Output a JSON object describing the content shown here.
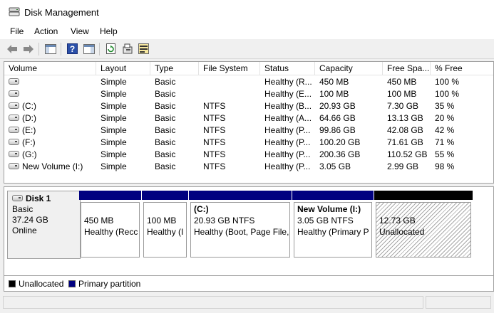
{
  "window": {
    "title": "Disk Management"
  },
  "menu": [
    "File",
    "Action",
    "View",
    "Help"
  ],
  "toolbar": {
    "buttons": [
      "back-icon",
      "forward-icon",
      "console-tree-icon",
      "help-icon",
      "show-hide-icon",
      "refresh-icon",
      "properties-icon",
      "rescan-disks-icon"
    ]
  },
  "volume_list": {
    "columns": [
      "Volume",
      "Layout",
      "Type",
      "File System",
      "Status",
      "Capacity",
      "Free Spa...",
      "% Free"
    ],
    "rows": [
      {
        "volume": "",
        "layout": "Simple",
        "type": "Basic",
        "fs": "",
        "status": "Healthy (R...",
        "capacity": "450 MB",
        "free": "450 MB",
        "pct": "100 %"
      },
      {
        "volume": "",
        "layout": "Simple",
        "type": "Basic",
        "fs": "",
        "status": "Healthy (E...",
        "capacity": "100 MB",
        "free": "100 MB",
        "pct": "100 %"
      },
      {
        "volume": "(C:)",
        "layout": "Simple",
        "type": "Basic",
        "fs": "NTFS",
        "status": "Healthy (B...",
        "capacity": "20.93 GB",
        "free": "7.30 GB",
        "pct": "35 %"
      },
      {
        "volume": "(D:)",
        "layout": "Simple",
        "type": "Basic",
        "fs": "NTFS",
        "status": "Healthy (A...",
        "capacity": "64.66 GB",
        "free": "13.13 GB",
        "pct": "20 %"
      },
      {
        "volume": "(E:)",
        "layout": "Simple",
        "type": "Basic",
        "fs": "NTFS",
        "status": "Healthy (P...",
        "capacity": "99.86 GB",
        "free": "42.08 GB",
        "pct": "42 %"
      },
      {
        "volume": "(F:)",
        "layout": "Simple",
        "type": "Basic",
        "fs": "NTFS",
        "status": "Healthy (P...",
        "capacity": "100.20 GB",
        "free": "71.61 GB",
        "pct": "71 %"
      },
      {
        "volume": "(G:)",
        "layout": "Simple",
        "type": "Basic",
        "fs": "NTFS",
        "status": "Healthy (P...",
        "capacity": "200.36 GB",
        "free": "110.52 GB",
        "pct": "55 %"
      },
      {
        "volume": "New Volume (I:)",
        "layout": "Simple",
        "type": "Basic",
        "fs": "NTFS",
        "status": "Healthy (P...",
        "capacity": "3.05 GB",
        "free": "2.99 GB",
        "pct": "98 %"
      }
    ]
  },
  "disk": {
    "name": "Disk 1",
    "type": "Basic",
    "size": "37.24 GB",
    "state": "Online",
    "partitions": [
      {
        "title": "",
        "line1": "450 MB",
        "line2": "Healthy (Recc",
        "kind": "primary"
      },
      {
        "title": "",
        "line1": "100 MB",
        "line2": "Healthy (I",
        "kind": "primary"
      },
      {
        "title": "(C:)",
        "line1": "20.93 GB NTFS",
        "line2": "Healthy (Boot, Page File,",
        "kind": "primary"
      },
      {
        "title": "New Volume  (I:)",
        "line1": "3.05 GB NTFS",
        "line2": "Healthy (Primary P",
        "kind": "primary"
      },
      {
        "title": "",
        "line1": "12.73 GB",
        "line2": "Unallocated",
        "kind": "unallocated"
      }
    ]
  },
  "legend": [
    {
      "label": "Unallocated",
      "color": "#000000"
    },
    {
      "label": "Primary partition",
      "color": "#000080"
    }
  ]
}
